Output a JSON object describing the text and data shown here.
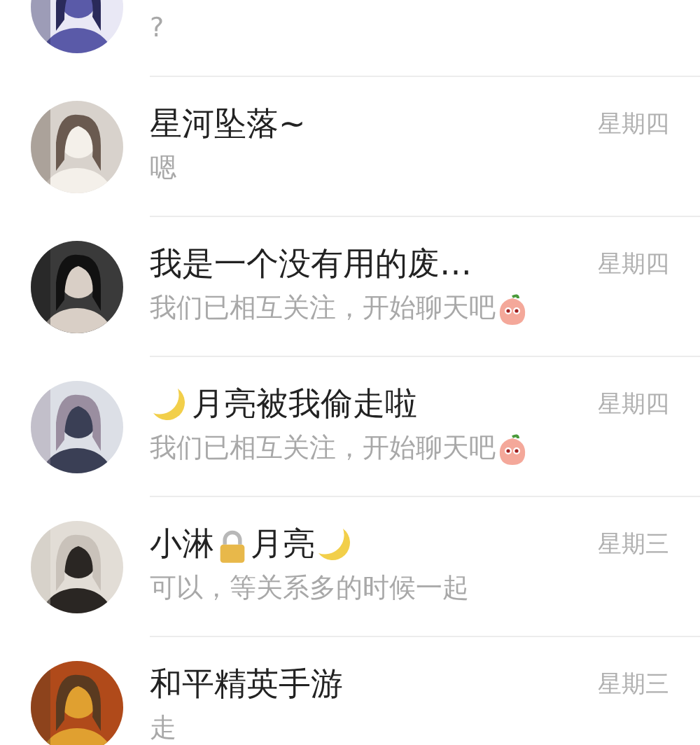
{
  "chats": [
    {
      "preview": "?",
      "sticker": false
    },
    {
      "name": [
        {
          "kind": "text",
          "text": "星河坠落~"
        }
      ],
      "preview": "嗯",
      "sticker": false,
      "time": "星期四"
    },
    {
      "name": [
        {
          "kind": "text",
          "text": "我是一个没有用的废…"
        }
      ],
      "preview": "我们已相互关注，开始聊天吧",
      "sticker": true,
      "time": "星期四"
    },
    {
      "name": [
        {
          "kind": "moon"
        },
        {
          "kind": "text",
          "text": "月亮被我偷走啦"
        }
      ],
      "preview": "我们已相互关注，开始聊天吧",
      "sticker": true,
      "time": "星期四"
    },
    {
      "name": [
        {
          "kind": "text",
          "text": "小淋"
        },
        {
          "kind": "lock"
        },
        {
          "kind": "text",
          "text": "月亮"
        },
        {
          "kind": "moon"
        }
      ],
      "preview": "可以，等关系多的时候一起",
      "sticker": false,
      "time": "星期三"
    },
    {
      "name": [
        {
          "kind": "text",
          "text": "和平精英手游"
        }
      ],
      "preview": "走",
      "sticker": false,
      "time": "星期三"
    }
  ]
}
